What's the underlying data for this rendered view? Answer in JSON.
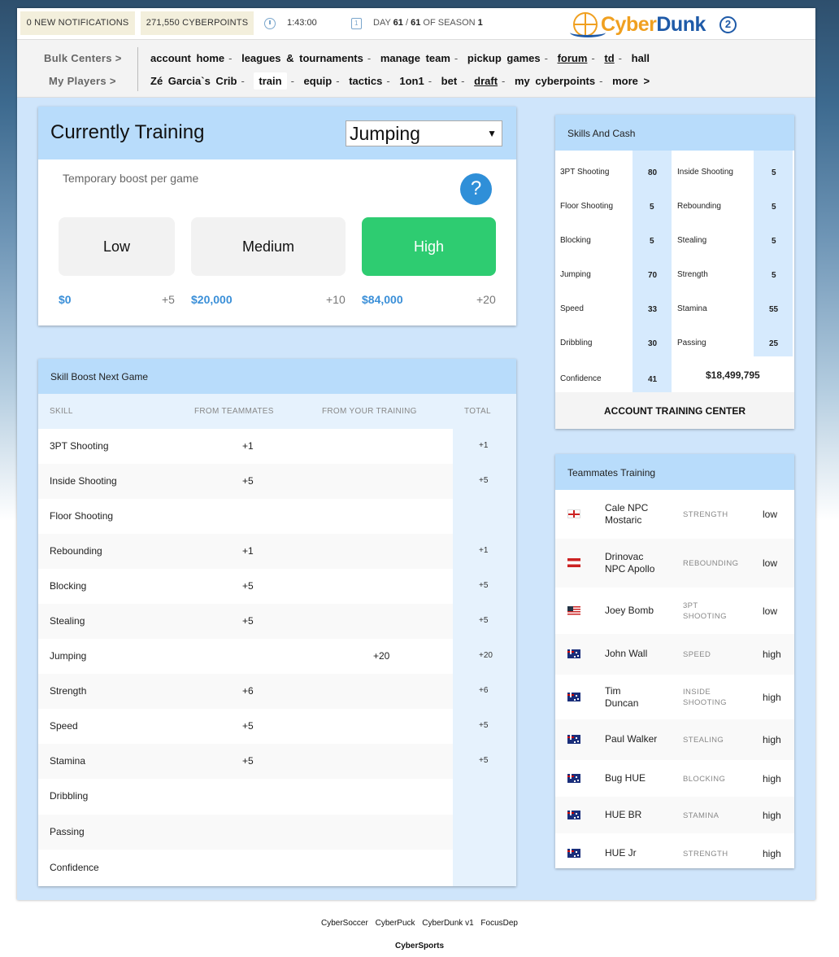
{
  "topbar": {
    "notifications": "0 NEW NOTIFICATIONS",
    "cyberpoints": "271,550 CYBERPOINTS",
    "timer": "1:43:00",
    "day_label": "DAY",
    "day_current": "61",
    "day_sep": " / ",
    "day_total": "61",
    "season_label": " OF SEASON ",
    "season": "1",
    "logo_cyber": "Cyber",
    "logo_dunk": "Dunk",
    "logo_num": "2"
  },
  "nav": {
    "bulk_centers": "Bulk Centers >",
    "my_players": "My Players >",
    "row1": [
      "account home",
      "leagues & tournaments",
      "manage team",
      "pickup games",
      "forum",
      "td",
      "hall"
    ],
    "row2": [
      "Zé Garcia`s Crib",
      "train",
      "equip",
      "tactics",
      "1on1",
      "bet",
      "draft",
      "my cyberpoints",
      "more >"
    ]
  },
  "training": {
    "title": "Currently Training",
    "selected_skill": "Jumping",
    "boost_text": "Temporary boost per game",
    "help": "?",
    "options": [
      {
        "label": "Low",
        "price": "$0",
        "boost": "+5"
      },
      {
        "label": "Medium",
        "price": "$20,000",
        "boost": "+10"
      },
      {
        "label": "High",
        "price": "$84,000",
        "boost": "+20"
      }
    ]
  },
  "boost": {
    "title": "Skill Boost Next Game",
    "headers": [
      "SKILL",
      "FROM TEAMMATES",
      "FROM YOUR TRAINING",
      "TOTAL"
    ],
    "rows": [
      {
        "skill": "3PT Shooting",
        "team": "+1",
        "your": "",
        "total": "+1"
      },
      {
        "skill": "Inside Shooting",
        "team": "+5",
        "your": "",
        "total": "+5"
      },
      {
        "skill": "Floor Shooting",
        "team": "",
        "your": "",
        "total": ""
      },
      {
        "skill": "Rebounding",
        "team": "+1",
        "your": "",
        "total": "+1"
      },
      {
        "skill": "Blocking",
        "team": "+5",
        "your": "",
        "total": "+5"
      },
      {
        "skill": "Stealing",
        "team": "+5",
        "your": "",
        "total": "+5"
      },
      {
        "skill": "Jumping",
        "team": "",
        "your": "+20",
        "total": "+20"
      },
      {
        "skill": "Strength",
        "team": "+6",
        "your": "",
        "total": "+6"
      },
      {
        "skill": "Speed",
        "team": "+5",
        "your": "",
        "total": "+5"
      },
      {
        "skill": "Stamina",
        "team": "+5",
        "your": "",
        "total": "+5"
      },
      {
        "skill": "Dribbling",
        "team": "",
        "your": "",
        "total": ""
      },
      {
        "skill": "Passing",
        "team": "",
        "your": "",
        "total": ""
      },
      {
        "skill": "Confidence",
        "team": "",
        "your": "",
        "total": ""
      }
    ]
  },
  "skills": {
    "title": "Skills And Cash",
    "left": [
      {
        "name": "3PT Shooting",
        "value": "80"
      },
      {
        "name": "Floor Shooting",
        "value": "5"
      },
      {
        "name": "Blocking",
        "value": "5"
      },
      {
        "name": "Jumping",
        "value": "70"
      },
      {
        "name": "Speed",
        "value": "33"
      },
      {
        "name": "Dribbling",
        "value": "30"
      },
      {
        "name": "Confidence",
        "value": "41"
      }
    ],
    "right": [
      {
        "name": "Inside Shooting",
        "value": "5"
      },
      {
        "name": "Rebounding",
        "value": "5"
      },
      {
        "name": "Stealing",
        "value": "5"
      },
      {
        "name": "Strength",
        "value": "5"
      },
      {
        "name": "Stamina",
        "value": "55"
      },
      {
        "name": "Passing",
        "value": "25"
      }
    ],
    "cash": "$18,499,795",
    "training_center": "ACCOUNT TRAINING CENTER"
  },
  "mates": {
    "title": "Teammates Training",
    "rows": [
      {
        "flag": "georgia-flag-icon",
        "name1": "Cale NPC",
        "name2": "Mostaric",
        "skill1": "STRENGTH",
        "skill2": "",
        "level": "low"
      },
      {
        "flag": "austria-flag-icon",
        "name1": "Drinovac",
        "name2": "NPC Apollo",
        "skill1": "REBOUNDING",
        "skill2": "",
        "level": "low"
      },
      {
        "flag": "usa-flag-icon",
        "name1": "Joey Bomb",
        "name2": "",
        "skill1": "3PT",
        "skill2": "SHOOTING",
        "level": "low"
      },
      {
        "flag": "australia-flag-icon",
        "name1": "John Wall",
        "name2": "",
        "skill1": "SPEED",
        "skill2": "",
        "level": "high"
      },
      {
        "flag": "australia-flag-icon",
        "name1": "Tim",
        "name2": "Duncan",
        "skill1": "INSIDE",
        "skill2": "SHOOTING",
        "level": "high"
      },
      {
        "flag": "australia-flag-icon",
        "name1": "Paul Walker",
        "name2": "",
        "skill1": "STEALING",
        "skill2": "",
        "level": "high"
      },
      {
        "flag": "australia-flag-icon",
        "name1": "Bug HUE",
        "name2": "",
        "skill1": "BLOCKING",
        "skill2": "",
        "level": "high"
      },
      {
        "flag": "australia-flag-icon",
        "name1": "HUE BR",
        "name2": "",
        "skill1": "STAMINA",
        "skill2": "",
        "level": "high"
      },
      {
        "flag": "australia-flag-icon",
        "name1": "HUE Jr",
        "name2": "",
        "skill1": "STRENGTH",
        "skill2": "",
        "level": "high"
      }
    ]
  },
  "footer": {
    "links": [
      "CyberSoccer",
      "CyberPuck",
      "CyberDunk v1",
      "FocusDep"
    ],
    "brand": "CyberSports"
  },
  "colors": {
    "accent_blue": "#2f8fd8",
    "panel_header": "#b8dcfb",
    "high_green": "#2ecc71",
    "content_bg": "#cfe5fb"
  }
}
